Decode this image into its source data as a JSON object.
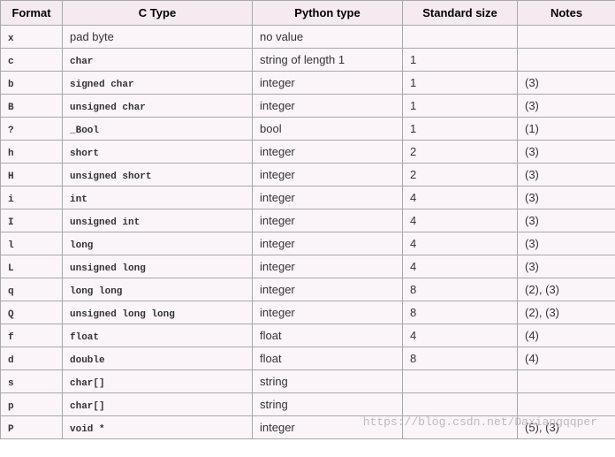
{
  "headers": [
    "Format",
    "C Type",
    "Python type",
    "Standard size",
    "Notes"
  ],
  "rows": [
    {
      "format": "x",
      "ctype": "pad byte",
      "ctype_mono": false,
      "python": "no value",
      "size": "",
      "notes": ""
    },
    {
      "format": "c",
      "ctype": "char",
      "ctype_mono": true,
      "python": "string of length 1",
      "size": "1",
      "notes": ""
    },
    {
      "format": "b",
      "ctype": "signed char",
      "ctype_mono": true,
      "python": "integer",
      "size": "1",
      "notes": "(3)"
    },
    {
      "format": "B",
      "ctype": "unsigned char",
      "ctype_mono": true,
      "python": "integer",
      "size": "1",
      "notes": "(3)"
    },
    {
      "format": "?",
      "ctype": "_Bool",
      "ctype_mono": true,
      "python": "bool",
      "size": "1",
      "notes": "(1)"
    },
    {
      "format": "h",
      "ctype": "short",
      "ctype_mono": true,
      "python": "integer",
      "size": "2",
      "notes": "(3)"
    },
    {
      "format": "H",
      "ctype": "unsigned short",
      "ctype_mono": true,
      "python": "integer",
      "size": "2",
      "notes": "(3)"
    },
    {
      "format": "i",
      "ctype": "int",
      "ctype_mono": true,
      "python": "integer",
      "size": "4",
      "notes": "(3)"
    },
    {
      "format": "I",
      "ctype": "unsigned int",
      "ctype_mono": true,
      "python": "integer",
      "size": "4",
      "notes": "(3)"
    },
    {
      "format": "l",
      "ctype": "long",
      "ctype_mono": true,
      "python": "integer",
      "size": "4",
      "notes": "(3)"
    },
    {
      "format": "L",
      "ctype": "unsigned long",
      "ctype_mono": true,
      "python": "integer",
      "size": "4",
      "notes": "(3)"
    },
    {
      "format": "q",
      "ctype": "long long",
      "ctype_mono": true,
      "python": "integer",
      "size": "8",
      "notes": "(2), (3)"
    },
    {
      "format": "Q",
      "ctype": "unsigned long long",
      "ctype_mono": true,
      "python": "integer",
      "size": "8",
      "notes": "(2), (3)"
    },
    {
      "format": "f",
      "ctype": "float",
      "ctype_mono": true,
      "python": "float",
      "size": "4",
      "notes": "(4)"
    },
    {
      "format": "d",
      "ctype": "double",
      "ctype_mono": true,
      "python": "float",
      "size": "8",
      "notes": "(4)"
    },
    {
      "format": "s",
      "ctype": "char[]",
      "ctype_mono": true,
      "python": "string",
      "size": "",
      "notes": ""
    },
    {
      "format": "p",
      "ctype": "char[]",
      "ctype_mono": true,
      "python": "string",
      "size": "",
      "notes": ""
    },
    {
      "format": "P",
      "ctype": "void *",
      "ctype_mono": true,
      "python": "integer",
      "size": "",
      "notes": "(5), (3)"
    }
  ],
  "watermark": "https://blog.csdn.net/Daxiangqqper"
}
